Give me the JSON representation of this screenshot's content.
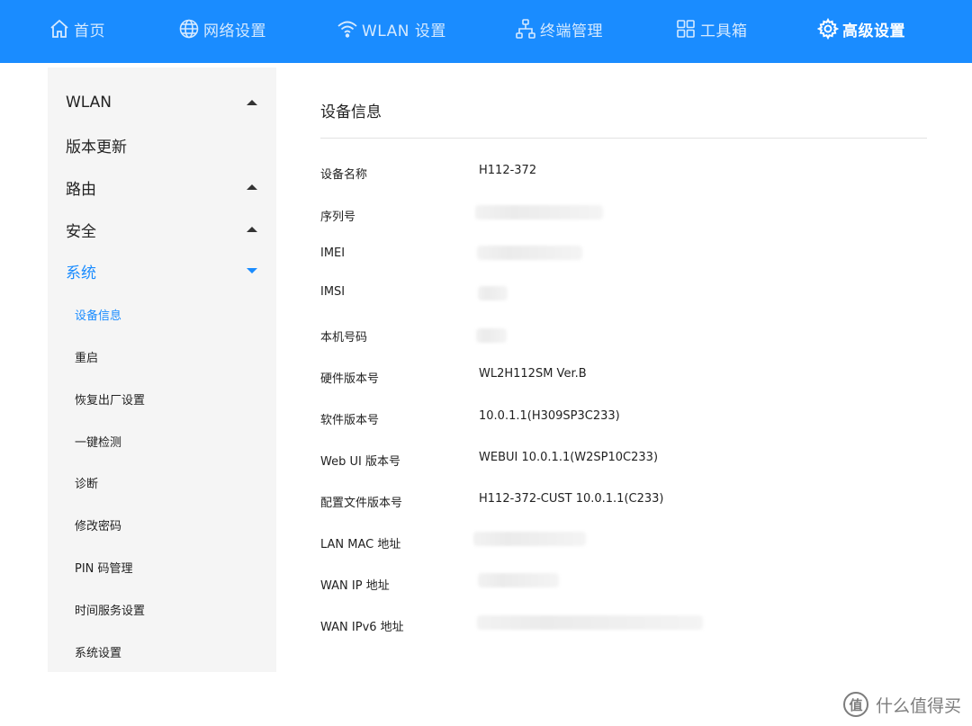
{
  "nav": {
    "items": [
      {
        "label": "首页",
        "icon": "home-icon"
      },
      {
        "label": "网络设置",
        "icon": "globe-icon"
      },
      {
        "label": "WLAN 设置",
        "icon": "wifi-icon"
      },
      {
        "label": "终端管理",
        "icon": "devices-tree-icon"
      },
      {
        "label": "工具箱",
        "icon": "toolbox-grid-icon"
      },
      {
        "label": "高级设置",
        "icon": "gear-icon"
      }
    ],
    "active_index": 5,
    "bg_color": "#1a8cff"
  },
  "sidebar": {
    "sections": [
      {
        "label": "WLAN",
        "expandable": true,
        "expanded": false
      },
      {
        "label": "版本更新",
        "expandable": false
      },
      {
        "label": "路由",
        "expandable": true,
        "expanded": false
      },
      {
        "label": "安全",
        "expandable": true,
        "expanded": false
      },
      {
        "label": "系统",
        "expandable": true,
        "expanded": true
      }
    ],
    "sub_items": [
      {
        "label": "设备信息",
        "active": true
      },
      {
        "label": "重启"
      },
      {
        "label": "恢复出厂设置"
      },
      {
        "label": "一键检测"
      },
      {
        "label": "诊断"
      },
      {
        "label": "修改密码"
      },
      {
        "label": "PIN 码管理"
      },
      {
        "label": "时间服务设置"
      },
      {
        "label": "系统设置"
      }
    ]
  },
  "main": {
    "title": "设备信息",
    "rows": [
      {
        "label": "设备名称",
        "value": "H112-372"
      },
      {
        "label": "序列号",
        "value": ""
      },
      {
        "label": "IMEI",
        "value": ""
      },
      {
        "label": "IMSI",
        "value": ""
      },
      {
        "label": "本机号码",
        "value": ""
      },
      {
        "label": "硬件版本号",
        "value": "WL2H112SM Ver.B"
      },
      {
        "label": "软件版本号",
        "value": "10.0.1.1(H309SP3C233)"
      },
      {
        "label": "Web UI 版本号",
        "value": "WEBUI 10.0.1.1(W2SP10C233)"
      },
      {
        "label": "配置文件版本号",
        "value": "H112-372-CUST 10.0.1.1(C233)"
      },
      {
        "label": "LAN MAC 地址",
        "value": ""
      },
      {
        "label": "WAN IP 地址",
        "value": ""
      },
      {
        "label": "WAN IPv6 地址",
        "value": ""
      }
    ]
  },
  "watermark": {
    "text": "什么值得买",
    "logo_char": "值"
  }
}
